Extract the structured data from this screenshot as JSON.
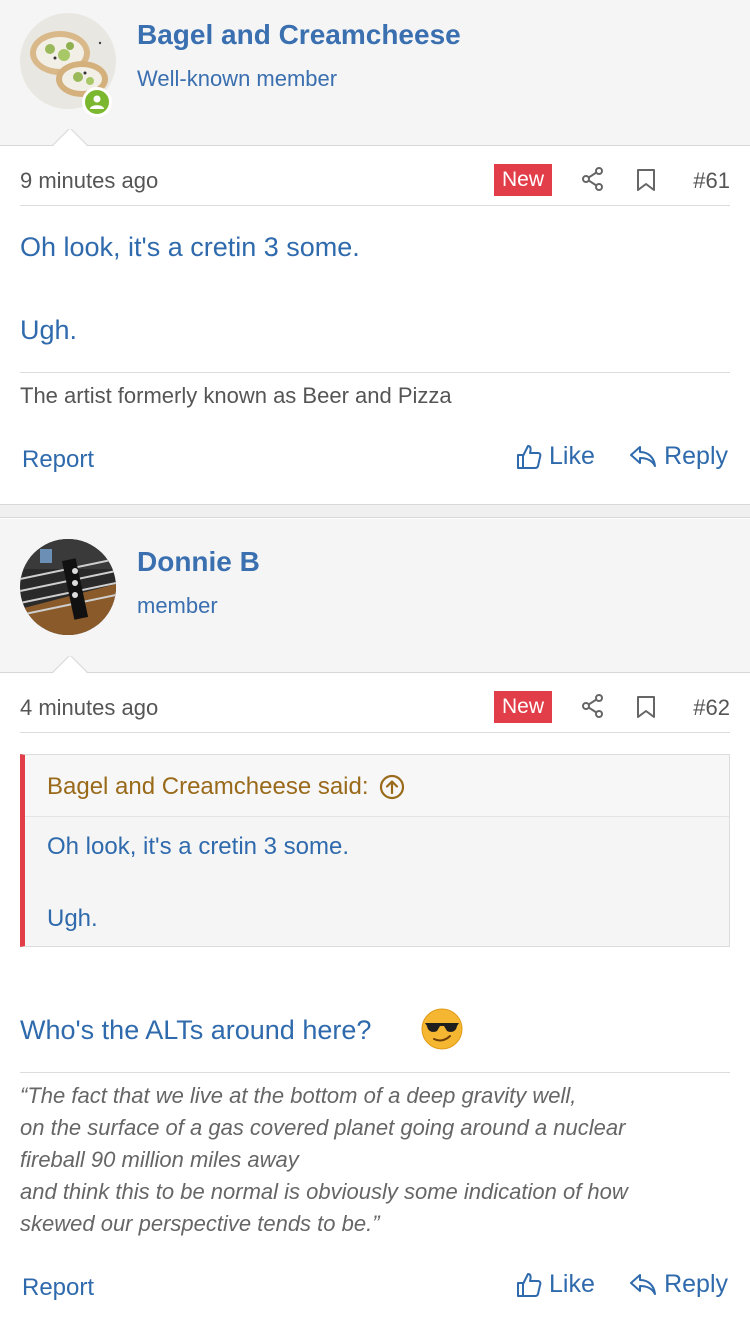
{
  "posts": [
    {
      "author": "Bagel and Creamcheese",
      "user_title": "Well-known member",
      "time": "9 minutes ago",
      "badge": "New",
      "number": "#61",
      "lines": [
        "Oh look, it's a cretin 3 some.",
        "Ugh."
      ],
      "signature": "The artist formerly known as Beer and Pizza",
      "actions": {
        "report": "Report",
        "like": "Like",
        "reply": "Reply"
      }
    },
    {
      "author": "Donnie B",
      "user_title": "member",
      "time": "4 minutes ago",
      "badge": "New",
      "number": "#62",
      "quote": {
        "header": "Bagel and Creamcheese said:",
        "lines": [
          "Oh look, it's a cretin 3 some.",
          "Ugh."
        ]
      },
      "body": "Who's the ALTs around here?",
      "signature_lines": [
        "“The fact that we live at the bottom of a deep gravity well,",
        "on the surface of a gas covered planet going around a nuclear",
        "fireball 90 million miles away",
        "and think this to be normal is obviously some indication of how",
        "skewed our perspective tends to be.”"
      ],
      "actions": {
        "report": "Report",
        "like": "Like",
        "reply": "Reply"
      }
    }
  ],
  "colors": {
    "link": "#2f6aad",
    "new_badge": "#e23e49",
    "quote_author": "#9a6a1b",
    "online": "#7cb82f"
  },
  "icons": [
    "share-icon",
    "bookmark-icon",
    "thumbs-up-icon",
    "reply-arrow-icon",
    "arrow-up-circle-icon",
    "sunglasses-emoji",
    "user-online-icon"
  ]
}
